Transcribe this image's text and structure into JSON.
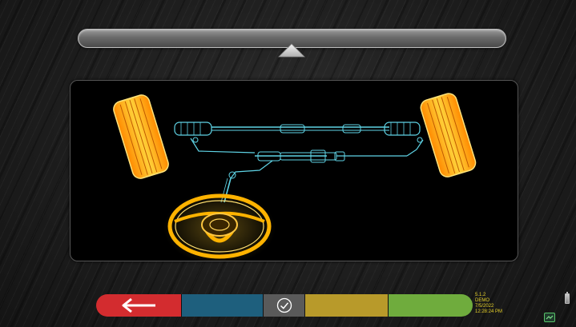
{
  "window": {
    "background": "#1b1b1b"
  },
  "slider": {
    "marker_icon": "triangle-up-icon"
  },
  "viewport": {
    "illustration": "steering-system-diagram",
    "wheel_color": "#ffb300",
    "linkage_color": "#5fd4e6"
  },
  "toolbar": {
    "back_icon": "arrow-left-icon",
    "check_icon": "checkmark-circle-icon",
    "colors": {
      "back": "#d32c2f",
      "blue": "#1e5f7d",
      "check": "#5a5a5a",
      "gold": "#b89a2a",
      "green": "#6fac3d"
    }
  },
  "status": {
    "version": "5.1.2",
    "mode": "DEMO",
    "date": "7/5/2022",
    "time": "12:28:24 PM",
    "battery_icon": "battery-icon",
    "network_icon": "network-icon"
  }
}
